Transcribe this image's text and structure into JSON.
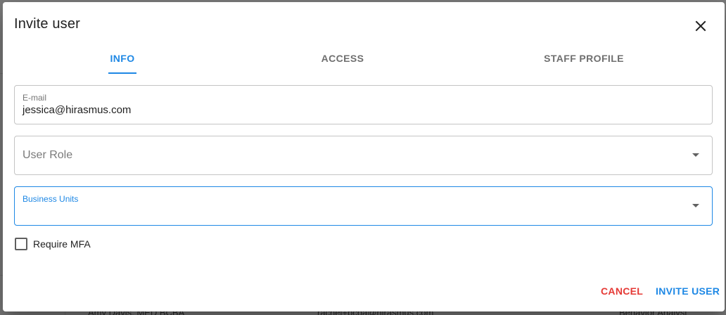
{
  "dialog": {
    "title": "Invite user",
    "close_icon": "close-icon"
  },
  "tabs": [
    {
      "label": "INFO",
      "active": true
    },
    {
      "label": "ACCESS",
      "active": false
    },
    {
      "label": "STAFF PROFILE",
      "active": false
    }
  ],
  "form": {
    "email": {
      "label": "E-mail",
      "value": "jessica@hirasmus.com"
    },
    "user_role": {
      "label": "User Role",
      "value": ""
    },
    "business_units": {
      "label": "Business Units",
      "value": "",
      "focused": true
    },
    "require_mfa": {
      "label": "Require MFA",
      "checked": false
    }
  },
  "actions": {
    "cancel_label": "CANCEL",
    "invite_label": "INVITE USER"
  },
  "background_row": {
    "name": "Amy Davis, MED BCBA",
    "email": "rachel+bcba@hirasmus.com",
    "role": "Behavior Analyst"
  },
  "colors": {
    "accent": "#1e88e5",
    "cancel": "#e53935",
    "overlay": "#7b7b7b"
  }
}
